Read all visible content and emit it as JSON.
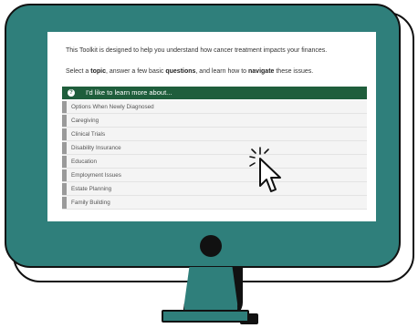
{
  "screen": {
    "intro": "This Toolkit is designed to help you understand how cancer treatment impacts your finances.",
    "select_prefix": "Select a ",
    "select_topic": "topic",
    "select_mid1": ", answer a few basic ",
    "select_questions": "questions",
    "select_mid2": ", and learn how to ",
    "select_navigate": "navigate",
    "select_suffix": " these issues.",
    "panel_title": "I'd like to learn more about...",
    "topics": [
      "Options When Newly Diagnosed",
      "Caregiving",
      "Clinical Trials",
      "Disability Insurance",
      "Education",
      "Employment Issues",
      "Estate Planning",
      "Family Building"
    ]
  },
  "colors": {
    "monitor": "#2f7f7b",
    "header": "#1f5e3c"
  }
}
